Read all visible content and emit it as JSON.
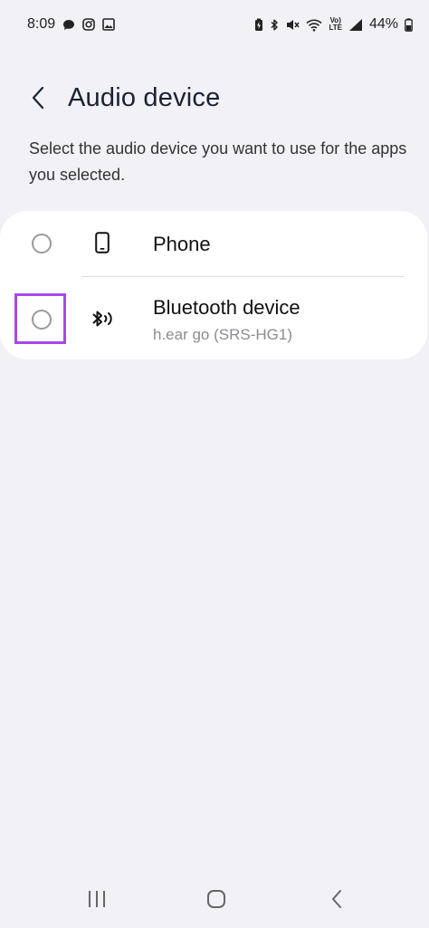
{
  "status_bar": {
    "time": "8:09",
    "network_label": "Vo)\nLTE",
    "battery_percent": "44%",
    "left_icons": [
      "chat-bubble-icon",
      "instagram-icon",
      "gallery-icon"
    ],
    "right_icons": [
      "battery-saver-icon",
      "bluetooth-icon",
      "mute-icon",
      "wifi-icon",
      "volte-icon",
      "signal-icon",
      "battery-icon"
    ]
  },
  "header": {
    "title": "Audio device",
    "back_icon": "chevron-left-icon"
  },
  "description": "Select the audio device you want to use for the apps you selected.",
  "devices": [
    {
      "label": "Phone",
      "sublabel": "",
      "icon": "phone-icon",
      "selected": false
    },
    {
      "label": "Bluetooth device",
      "sublabel": "h.ear go (SRS-HG1)",
      "icon": "bluetooth-audio-icon",
      "selected": false,
      "highlighted": true
    }
  ],
  "colors": {
    "background": "#F1F1F6",
    "card": "#FFFFFF",
    "highlight": "#A848E6",
    "title": "#1A2233"
  },
  "nav_bar": {
    "icons": [
      "recent-apps-icon",
      "home-icon",
      "back-icon"
    ]
  }
}
